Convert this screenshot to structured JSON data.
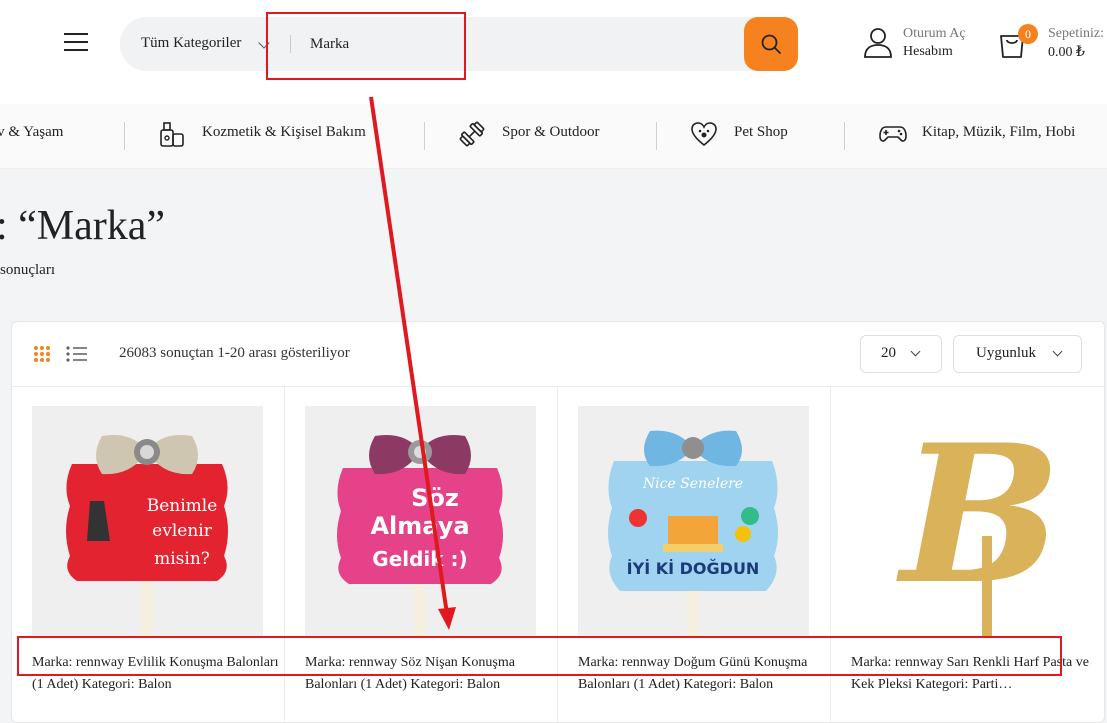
{
  "header": {
    "category_label": "Tüm Kategoriler",
    "search_value": "Marka",
    "account_line1": "Oturum Aç",
    "account_line2": "Hesabım",
    "cart_count": "0",
    "cart_label": "Sepetiniz:",
    "cart_total": "0.00 ₺"
  },
  "categories": [
    {
      "label": "Ev & Yaşam",
      "icon": "home-icon"
    },
    {
      "label": "Kozmetik & Kişisel Bakım",
      "icon": "cosmetics-icon"
    },
    {
      "label": "Spor & Outdoor",
      "icon": "dumbbell-icon"
    },
    {
      "label": "Pet Shop",
      "icon": "pet-heart-icon"
    },
    {
      "label": "Kitap, Müzik, Film, Hobi",
      "icon": "gamepad-icon"
    }
  ],
  "page": {
    "title": ": “Marka”",
    "subtitle": "sonuçları"
  },
  "toolbar": {
    "result_count": "26083 sonuçtan 1-20 arası gösteriliyor",
    "per_page": "20",
    "sort": "Uygunluk"
  },
  "products": [
    {
      "name": "Marka: rennway Evlilik Konuşma Balonları (1 Adet) Kategori: Balon",
      "image_text": "Benimle evlenir misin?",
      "image_bg": "#e3232f"
    },
    {
      "name": "Marka: rennway Söz Nişan Konuşma Balonları (1 Adet) Kategori: Balon",
      "image_text": "Söz Almaya Geldik :)",
      "image_bg": "#e6428a"
    },
    {
      "name": "Marka: rennway Doğum Günü Konuşma Balonları (1 Adet) Kategori: Balon",
      "image_text": "Nice Senelere İYİ Kİ DOĞDUN",
      "image_bg": "#9fd3ef"
    },
    {
      "name": "Marka: rennway Sarı Renkli Harf Pasta ve Kek Pleksi Kategori: Parti…",
      "image_text": "B",
      "image_bg": "#d9b25a"
    }
  ],
  "colors": {
    "accent": "#f5821f",
    "annotation": "#e0191e"
  }
}
